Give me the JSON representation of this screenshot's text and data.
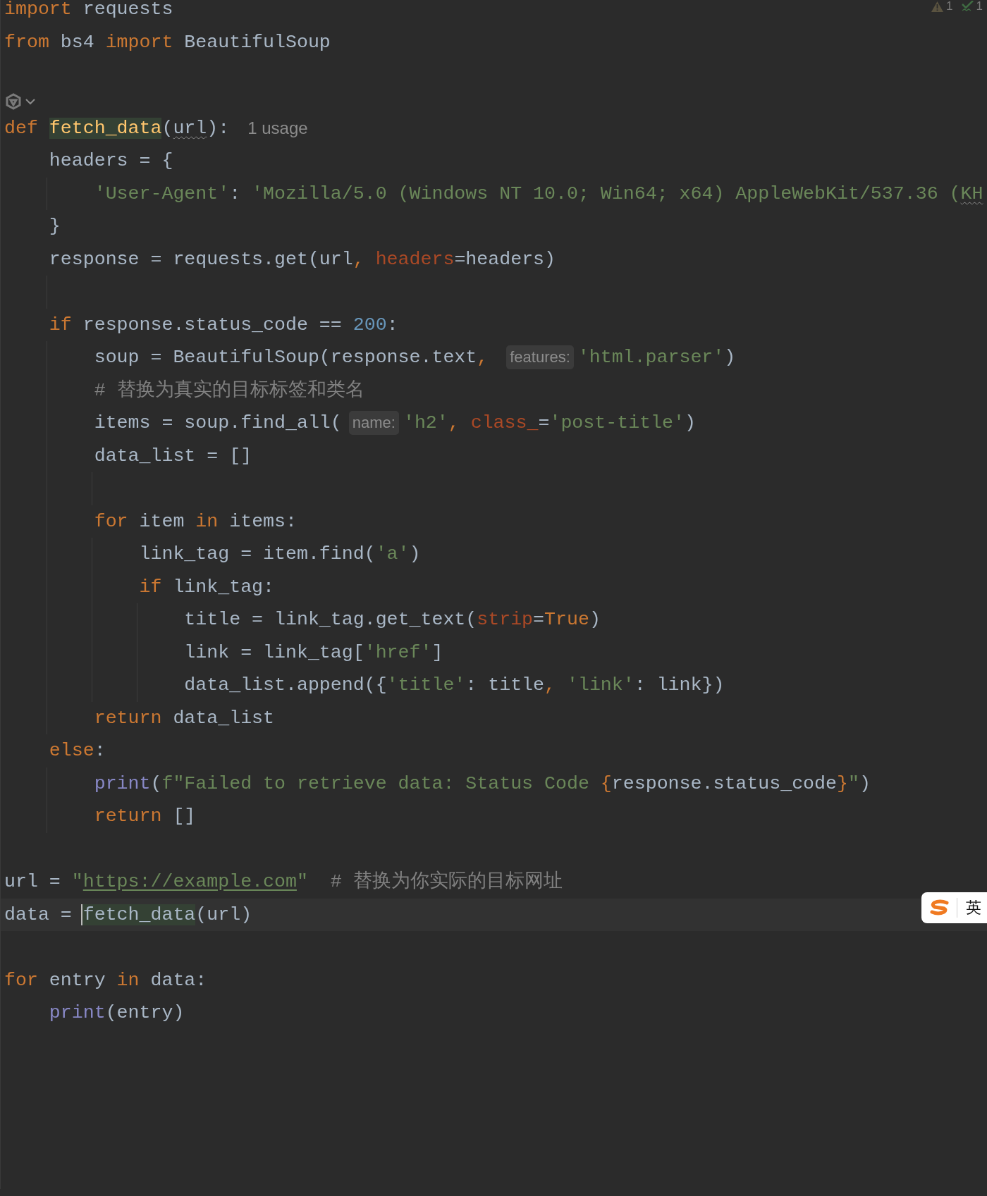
{
  "inspections": [
    {
      "kind": "warning",
      "count": "1"
    },
    {
      "kind": "check",
      "count": "1"
    }
  ],
  "lines": [
    {
      "kind": "code",
      "tokens": [
        {
          "kind": "kw",
          "text": "import"
        },
        {
          "kind": "p",
          "text": " requests"
        }
      ]
    },
    {
      "kind": "code",
      "tokens": [
        {
          "kind": "kw",
          "text": "from"
        },
        {
          "kind": "p",
          "text": " bs4 "
        },
        {
          "kind": "kw",
          "text": "import"
        },
        {
          "kind": "p",
          "text": " BeautifulSoup"
        }
      ]
    },
    {
      "kind": "blank"
    },
    {
      "kind": "vision"
    },
    {
      "kind": "code",
      "tokens": [
        {
          "kind": "kw",
          "text": "def "
        },
        {
          "kind": "fn",
          "text": "fetch_data",
          "highlight": true
        },
        {
          "kind": "p",
          "text": "("
        },
        {
          "kind": "warn",
          "text": "url"
        },
        {
          "kind": "p",
          "text": "):"
        },
        {
          "kind": "usage",
          "text": "1 usage"
        }
      ]
    },
    {
      "kind": "code",
      "tokens": [
        {
          "kind": "p",
          "text": "    headers = {"
        }
      ]
    },
    {
      "kind": "code",
      "tokens": [
        {
          "kind": "str",
          "text": "        'User-Agent'"
        },
        {
          "kind": "p",
          "text": ": "
        },
        {
          "kind": "str",
          "text": "'Mozilla/5.0 (Windows NT 10.0; Win64; x64) AppleWebKit/537.36 ("
        },
        {
          "kind": "strwarn",
          "text": "KH"
        }
      ]
    },
    {
      "kind": "code",
      "tokens": [
        {
          "kind": "p",
          "text": "    }"
        }
      ]
    },
    {
      "kind": "code",
      "tokens": [
        {
          "kind": "p",
          "text": "    response = requests.get(url"
        },
        {
          "kind": "kw",
          "text": ", "
        },
        {
          "kind": "kwarg",
          "text": "headers"
        },
        {
          "kind": "p",
          "text": "=headers)"
        }
      ]
    },
    {
      "kind": "blank"
    },
    {
      "kind": "code",
      "tokens": [
        {
          "kind": "kw",
          "text": "    if"
        },
        {
          "kind": "p",
          "text": " response.status_code == "
        },
        {
          "kind": "num",
          "text": "200"
        },
        {
          "kind": "p",
          "text": ":"
        }
      ]
    },
    {
      "kind": "code",
      "tokens": [
        {
          "kind": "p",
          "text": "        soup = BeautifulSoup(response.text"
        },
        {
          "kind": "kw",
          "text": ", "
        },
        {
          "kind": "hint",
          "text": "features:"
        },
        {
          "kind": "str",
          "text": "'html.parser'"
        },
        {
          "kind": "p",
          "text": ")"
        }
      ]
    },
    {
      "kind": "code",
      "tokens": [
        {
          "kind": "cm",
          "text": "        # 替换为真实的目标标签和类名"
        }
      ]
    },
    {
      "kind": "code",
      "tokens": [
        {
          "kind": "p",
          "text": "        items = soup.find_all("
        },
        {
          "kind": "hint",
          "text": "name:"
        },
        {
          "kind": "str",
          "text": "'h2'"
        },
        {
          "kind": "kw",
          "text": ", "
        },
        {
          "kind": "kwarg",
          "text": "class_"
        },
        {
          "kind": "p",
          "text": "="
        },
        {
          "kind": "str",
          "text": "'post-title'"
        },
        {
          "kind": "p",
          "text": ")"
        }
      ]
    },
    {
      "kind": "code",
      "tokens": [
        {
          "kind": "p",
          "text": "        data_list = []"
        }
      ]
    },
    {
      "kind": "blank"
    },
    {
      "kind": "code",
      "tokens": [
        {
          "kind": "kw",
          "text": "        for"
        },
        {
          "kind": "p",
          "text": " item "
        },
        {
          "kind": "kw",
          "text": "in"
        },
        {
          "kind": "p",
          "text": " items:"
        }
      ]
    },
    {
      "kind": "code",
      "tokens": [
        {
          "kind": "p",
          "text": "            link_tag = item.find("
        },
        {
          "kind": "str",
          "text": "'a'"
        },
        {
          "kind": "p",
          "text": ")"
        }
      ]
    },
    {
      "kind": "code",
      "tokens": [
        {
          "kind": "kw",
          "text": "            if"
        },
        {
          "kind": "p",
          "text": " link_tag:"
        }
      ]
    },
    {
      "kind": "code",
      "tokens": [
        {
          "kind": "p",
          "text": "                title = link_tag.get_text("
        },
        {
          "kind": "kwarg",
          "text": "strip"
        },
        {
          "kind": "p",
          "text": "="
        },
        {
          "kind": "kw",
          "text": "True"
        },
        {
          "kind": "p",
          "text": ")"
        }
      ]
    },
    {
      "kind": "code",
      "tokens": [
        {
          "kind": "p",
          "text": "                link = link_tag["
        },
        {
          "kind": "str",
          "text": "'href'"
        },
        {
          "kind": "p",
          "text": "]"
        }
      ]
    },
    {
      "kind": "code",
      "tokens": [
        {
          "kind": "p",
          "text": "                data_list.append({"
        },
        {
          "kind": "str",
          "text": "'title'"
        },
        {
          "kind": "p",
          "text": ": title"
        },
        {
          "kind": "kw",
          "text": ", "
        },
        {
          "kind": "str",
          "text": "'link'"
        },
        {
          "kind": "p",
          "text": ": link})"
        }
      ]
    },
    {
      "kind": "code",
      "tokens": [
        {
          "kind": "kw",
          "text": "        return"
        },
        {
          "kind": "p",
          "text": " data_list"
        }
      ]
    },
    {
      "kind": "code",
      "tokens": [
        {
          "kind": "kw",
          "text": "    else"
        },
        {
          "kind": "p",
          "text": ":"
        }
      ]
    },
    {
      "kind": "code",
      "tokens": [
        {
          "kind": "bi",
          "text": "        print"
        },
        {
          "kind": "p",
          "text": "("
        },
        {
          "kind": "str",
          "text": "f\"Failed to retrieve data: Status Code "
        },
        {
          "kind": "kw",
          "text": "{"
        },
        {
          "kind": "p",
          "text": "response.status_code"
        },
        {
          "kind": "kw",
          "text": "}"
        },
        {
          "kind": "str",
          "text": "\""
        },
        {
          "kind": "p",
          "text": ")"
        }
      ]
    },
    {
      "kind": "code",
      "tokens": [
        {
          "kind": "kw",
          "text": "        return"
        },
        {
          "kind": "p",
          "text": " []"
        }
      ]
    },
    {
      "kind": "blank"
    },
    {
      "kind": "code",
      "tokens": [
        {
          "kind": "p",
          "text": "url = "
        },
        {
          "kind": "str",
          "text": "\""
        },
        {
          "kind": "link",
          "text": "https://example.com"
        },
        {
          "kind": "str",
          "text": "\""
        },
        {
          "kind": "cm",
          "text": "  # 替换为你实际的目标网址"
        }
      ]
    },
    {
      "kind": "code",
      "tokens": [
        {
          "kind": "p",
          "text": "data = "
        },
        {
          "kind": "p",
          "text": "fetch_data",
          "highlight": true,
          "caret": true
        },
        {
          "kind": "p",
          "text": "(url)"
        }
      ]
    },
    {
      "kind": "blank"
    },
    {
      "kind": "code",
      "tokens": [
        {
          "kind": "kw",
          "text": "for"
        },
        {
          "kind": "p",
          "text": " entry "
        },
        {
          "kind": "kw",
          "text": "in"
        },
        {
          "kind": "p",
          "text": " data:"
        }
      ]
    },
    {
      "kind": "code",
      "tokens": [
        {
          "kind": "bi",
          "text": "    print"
        },
        {
          "kind": "p",
          "text": "(entry)"
        }
      ]
    }
  ],
  "ime": {
    "label": "英"
  }
}
